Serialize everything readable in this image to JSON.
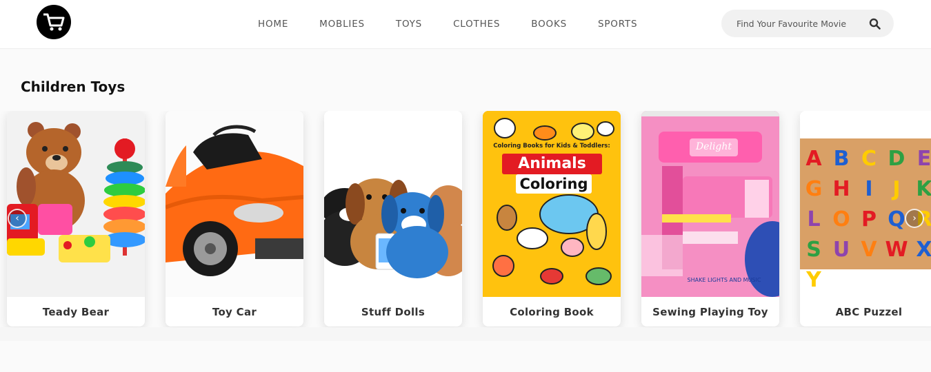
{
  "header": {
    "logo_icon": "shopping-cart-icon",
    "nav": [
      "HOME",
      "MOBLIES",
      "TOYS",
      "CLOTHES",
      "BOOKS",
      "SPORTS"
    ],
    "search_placeholder": "Find Your Favourite Movie",
    "search_icon": "magnifier-icon"
  },
  "section": {
    "title": "Children Toys",
    "products": [
      {
        "name": "Teady Bear"
      },
      {
        "name": "Toy Car"
      },
      {
        "name": "Stuff Dolls"
      },
      {
        "name": "Coloring Book"
      },
      {
        "name": "Sewing Playing Toy"
      },
      {
        "name": "ABC Puzzel"
      }
    ],
    "book_cover": {
      "top": "Coloring Books for Kids & Toddlers:",
      "line1": "Animals",
      "line2": "Coloring"
    },
    "sewing_brand": "Delight",
    "sewing_tag": "SHAKE LIGHTS AND MUSIC",
    "abc_letters": [
      "A",
      "B",
      "C",
      "D",
      "E",
      "G",
      "H",
      "I",
      "J",
      "K",
      "L",
      "O",
      "P",
      "Q",
      "R",
      "S",
      "U",
      "V",
      "W",
      "X",
      "Y"
    ]
  },
  "colors": {
    "accent": "#000000",
    "card_bg": "#ffffff",
    "page_bg": "#fafafa"
  }
}
